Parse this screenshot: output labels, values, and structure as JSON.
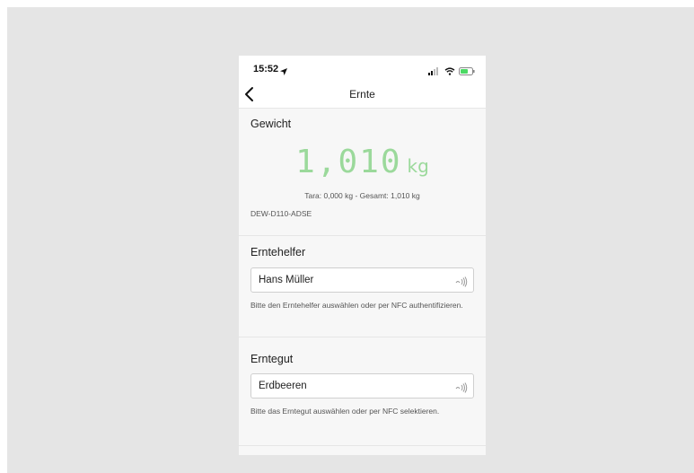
{
  "status_bar": {
    "time": "15:52",
    "icons": [
      "location-arrow-icon",
      "signal-icon",
      "wifi-icon",
      "battery-icon"
    ]
  },
  "nav": {
    "title": "Ernte",
    "back_icon": "chevron-left-icon"
  },
  "weight": {
    "section_title": "Gewicht",
    "value": "1,010",
    "unit": "kg",
    "details": "Tara: 0,000 kg - Gesamt: 1,010 kg",
    "device_id": "DEW-D110-ADSE",
    "value_color": "#9bd99b"
  },
  "helper": {
    "section_title": "Erntehelfer",
    "value": "Hans Müller",
    "hint": "Bitte den Erntehelfer auswählen oder per NFC authentifizieren.",
    "icon": "nfc-icon"
  },
  "crop": {
    "section_title": "Erntegut",
    "value": "Erdbeeren",
    "hint": "Bitte das Erntegut auswählen oder per NFC selektieren.",
    "icon": "nfc-icon"
  }
}
